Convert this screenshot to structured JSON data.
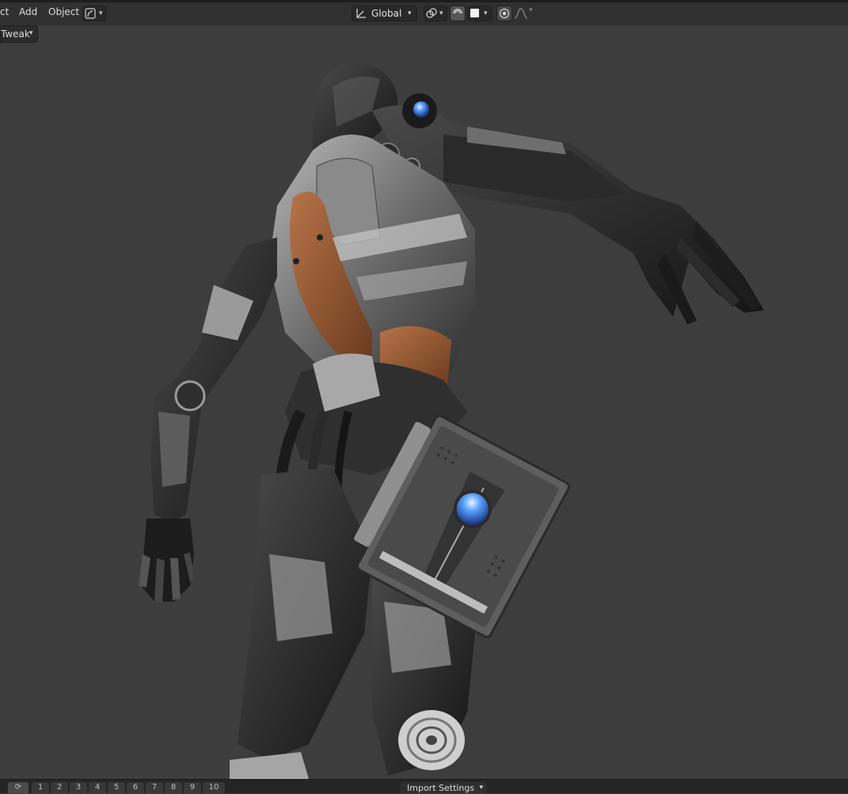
{
  "header": {
    "menu": [
      "ct",
      "Add",
      "Object"
    ],
    "transform_orientation": "Global"
  },
  "tool": {
    "mode": "Tweak"
  },
  "footer": {
    "layers": [
      "1",
      "2",
      "3",
      "4",
      "5",
      "6",
      "7",
      "8",
      "9",
      "10"
    ],
    "import_label": "Import Settings"
  },
  "colors": {
    "header_bg": "#303030",
    "viewport_bg": "#3d3d3d",
    "accent_blue": "#5aa0ff"
  },
  "icons": [
    "object-mode-icon",
    "transform-orientation-icon",
    "snap-icon",
    "proportional-edit-icon",
    "overlay-icon",
    "falloff-icon"
  ]
}
